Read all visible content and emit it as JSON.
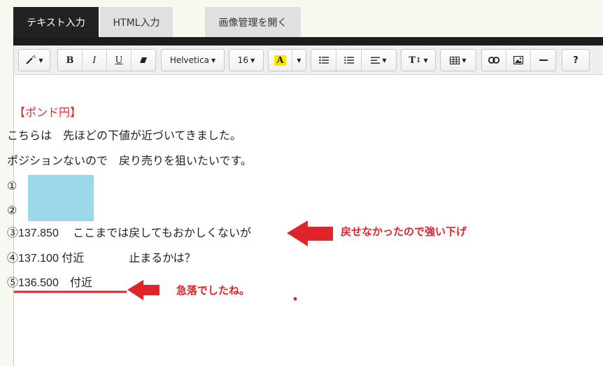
{
  "tabs": [
    {
      "label": "テキスト入力",
      "active": true
    },
    {
      "label": "HTML入力",
      "active": false
    },
    {
      "label": "画像管理を開く",
      "active": false
    }
  ],
  "toolbar": {
    "magic_icon": "magic-wand-icon",
    "bold_label": "B",
    "italic_label": "I",
    "underline_label": "U",
    "eraser_icon": "eraser-icon",
    "font_family": "Helvetica",
    "font_size": "16",
    "color_label": "A",
    "ul_icon": "unordered-list-icon",
    "ol_icon": "ordered-list-icon",
    "align_icon": "align-icon",
    "line_height_label": "T",
    "table_icon": "table-icon",
    "link_icon": "link-icon",
    "picture_icon": "picture-icon",
    "hr_icon": "horizontal-rule-icon",
    "help_label": "?",
    "highlight_color": "#ffe600"
  },
  "content": {
    "lines": [
      "【ポンド円】",
      "こちらは　先ほどの下値が近づいてきました。",
      "ポジションないので　戻り売りを狙いたいです。",
      "①",
      "②",
      "③137.850　 ここまでは戻してもおかしくないが",
      "④137.100 付近　　　　止まるかは？",
      "⑤136.500　付近"
    ],
    "title_color": "#e3262c",
    "mask_color": "#9cd8ea"
  },
  "annotations": {
    "note1": "戻せなかったので強い下げ",
    "note2": "急落でしたね。",
    "color": "#e0242c"
  }
}
